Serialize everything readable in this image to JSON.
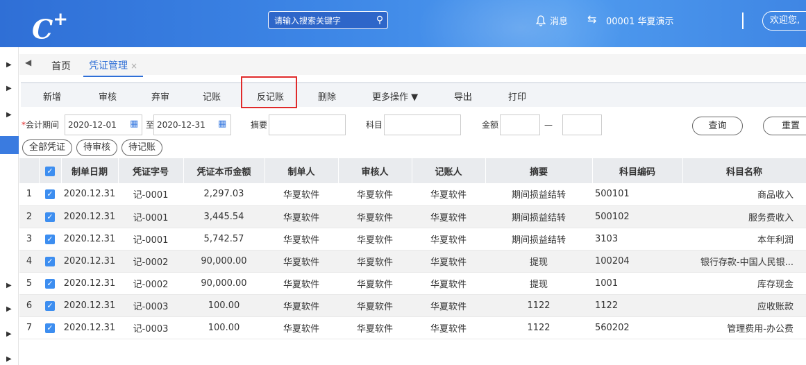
{
  "header": {
    "logo": "C",
    "logo_sup": "+",
    "search_placeholder": "请输入搜索关键字",
    "messages": "消息",
    "org": "00001 华夏演示",
    "welcome": "欢迎您, "
  },
  "tabs": {
    "home": "首页",
    "active": "凭证管理",
    "close": "×"
  },
  "toolbar": {
    "add": "新增",
    "audit": "审核",
    "unaudit": "弃审",
    "post": "记账",
    "unpost": "反记账",
    "delete": "删除",
    "more": "更多操作 ▼",
    "export": "导出",
    "print": "打印"
  },
  "filter": {
    "period_required": "*",
    "period_label": "会计期间",
    "period_from": "2020-12-01",
    "to": "至",
    "period_to": "2020-12-31",
    "summary_label": "摘要",
    "subject_label": "科目",
    "amount_label": "金额",
    "dash": "—",
    "query": "查询",
    "reset": "重置"
  },
  "chips": [
    "全部凭证",
    "待审核",
    "待记账"
  ],
  "table": {
    "columns": [
      "",
      "",
      "制单日期",
      "凭证字号",
      "凭证本币金额",
      "制单人",
      "审核人",
      "记账人",
      "摘要",
      "科目编码",
      "科目名称"
    ],
    "rows": [
      [
        "1",
        "2020.12.31",
        "记-0001",
        "2,297.03",
        "华夏软件",
        "华夏软件",
        "华夏软件",
        "期间损益结转",
        "500101",
        "商品收入"
      ],
      [
        "2",
        "2020.12.31",
        "记-0001",
        "3,445.54",
        "华夏软件",
        "华夏软件",
        "华夏软件",
        "期间损益结转",
        "500102",
        "服务费收入"
      ],
      [
        "3",
        "2020.12.31",
        "记-0001",
        "5,742.57",
        "华夏软件",
        "华夏软件",
        "华夏软件",
        "期间损益结转",
        "3103",
        "本年利润"
      ],
      [
        "4",
        "2020.12.31",
        "记-0002",
        "90,000.00",
        "华夏软件",
        "华夏软件",
        "华夏软件",
        "提现",
        "100204",
        "银行存款-中国人民银..."
      ],
      [
        "5",
        "2020.12.31",
        "记-0002",
        "90,000.00",
        "华夏软件",
        "华夏软件",
        "华夏软件",
        "提现",
        "1001",
        "库存现金"
      ],
      [
        "6",
        "2020.12.31",
        "记-0003",
        "100.00",
        "华夏软件",
        "华夏软件",
        "华夏软件",
        "1122",
        "1122",
        "应收账款"
      ],
      [
        "7",
        "2020.12.31",
        "记-0003",
        "100.00",
        "华夏软件",
        "华夏软件",
        "华夏软件",
        "1122",
        "560202",
        "管理费用-办公费"
      ]
    ]
  },
  "colors": {
    "header": "#3d86e6",
    "accent": "#2f6fd6",
    "highlight": "#e02a2a"
  }
}
